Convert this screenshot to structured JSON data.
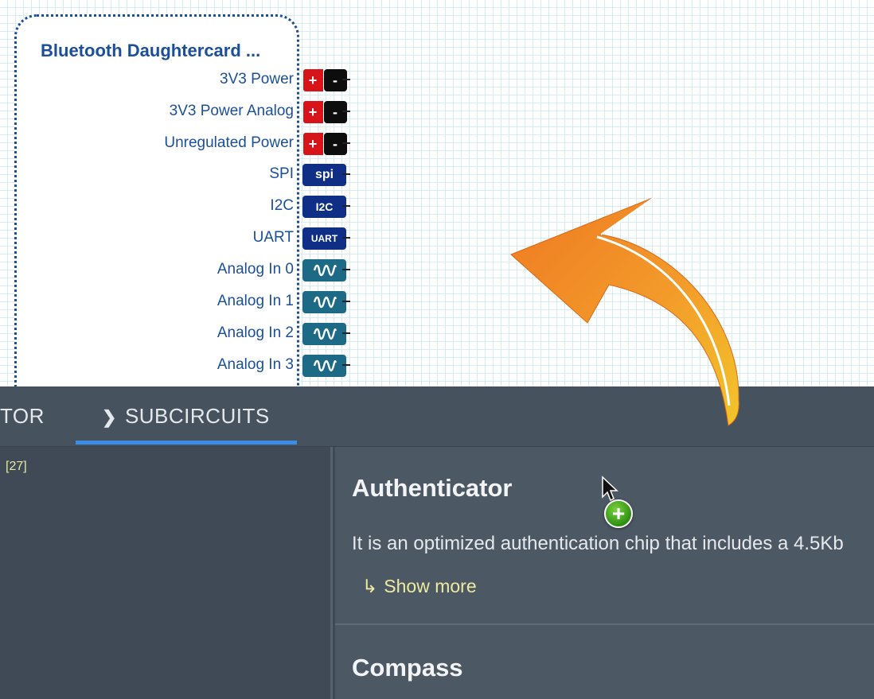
{
  "canvas": {
    "part": {
      "title": "Bluetooth Daughtercard ...",
      "pins": [
        {
          "label": "3V3 Power",
          "kind": "power",
          "plus": "+",
          "minus": "-"
        },
        {
          "label": "3V3 Power Analog",
          "kind": "power",
          "plus": "+",
          "minus": "-"
        },
        {
          "label": "Unregulated Power",
          "kind": "power",
          "plus": "+",
          "minus": "-"
        },
        {
          "label": "SPI",
          "kind": "bus",
          "chip": "spi"
        },
        {
          "label": "I2C",
          "kind": "bus",
          "chip": "I2C"
        },
        {
          "label": "UART",
          "kind": "bus",
          "chip": "UART"
        },
        {
          "label": "Analog In 0",
          "kind": "analog",
          "icon": "sine-wave-icon"
        },
        {
          "label": "Analog In 1",
          "kind": "analog",
          "icon": "sine-wave-icon"
        },
        {
          "label": "Analog In 2",
          "kind": "analog",
          "icon": "sine-wave-icon"
        },
        {
          "label": "Analog In 3",
          "kind": "analog",
          "icon": "sine-wave-icon"
        }
      ]
    }
  },
  "tabs": {
    "left_partial": "TOR",
    "subcircuits": "SUBCIRCUITS",
    "subcircuits_icon": "chevron-right-icon"
  },
  "list": {
    "count": "[27]"
  },
  "details": {
    "items": [
      {
        "title": "Authenticator",
        "description": "It is an optimized authentication chip that includes a 4.5Kb",
        "show_more": "Show more"
      },
      {
        "title": "Compass"
      }
    ]
  },
  "overlay": {
    "add_badge": "+",
    "arrow_icon": "curved-arrow-icon",
    "cursor_icon": "mouse-pointer-icon"
  },
  "colors": {
    "part_border": "#1b4f9a",
    "power_plus": "#d7141a",
    "power_minus": "#0d0d0d",
    "bus_chip": "#0f2f86",
    "analog_chip": "#1d6a86",
    "tab_underline": "#3a8ee6",
    "panel_bg": "#3f4a56",
    "show_more_text": "#eeeaa0",
    "arrow_orange": "#f08a24"
  }
}
